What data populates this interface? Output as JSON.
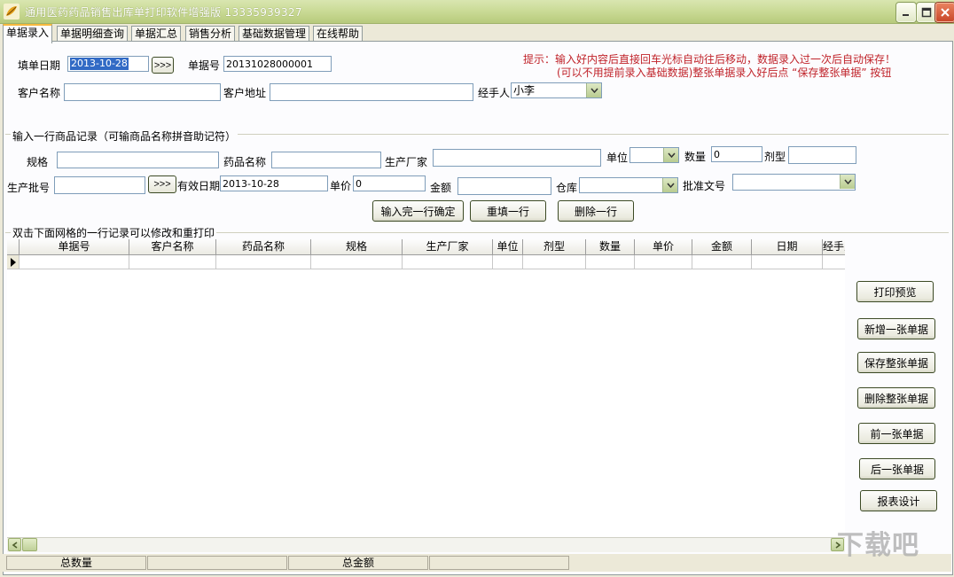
{
  "window": {
    "title": "通用医药药品销售出库单打印软件增强版 13335939327",
    "icon": "app-leaf-icon"
  },
  "tabs": [
    "单据录入",
    "单据明细查询",
    "单据汇总",
    "销售分析",
    "基础数据管理",
    "在线帮助"
  ],
  "header_form": {
    "date_label": "填单日期",
    "date_value": "2013-10-28",
    "date_picker_label": ">>>",
    "docno_label": "单据号",
    "docno_value": "20131028000001",
    "customer_label": "客户名称",
    "customer_value": "",
    "address_label": "客户地址",
    "address_value": "",
    "handler_label": "经手人",
    "handler_value": "小李",
    "hint_line1": "提示：输入好内容后直接回车光标自动往后移动，数据录入过一次后自动保存！",
    "hint_line2": "(可以不用提前录入基础数据)整张单据录入好后点 “保存整张单据” 按钮"
  },
  "item_form": {
    "group_title": "输入一行商品记录（可输商品名称拼音助记符）",
    "spec_label": "规格",
    "drug_label": "药品名称",
    "maker_label": "生产厂家",
    "unit_label": "单位",
    "qty_label": "数量",
    "qty_value": "0",
    "form_label": "剂型",
    "batch_label": "生产批号",
    "batch_btn_label": ">>>",
    "expiry_label": "有效日期",
    "expiry_value": "2013-10-28",
    "price_label": "单价",
    "price_value": "0",
    "amount_label": "金额",
    "warehouse_label": "仓库",
    "approval_label": "批准文号",
    "btn_confirm": "输入完一行确定",
    "btn_refill": "重填一行",
    "btn_delete_row": "删除一行"
  },
  "grid": {
    "group_title": "双击下面网格的一行记录可以修改和重打印",
    "columns": [
      "单据号",
      "客户名称",
      "药品名称",
      "规格",
      "生产厂家",
      "单位",
      "剂型",
      "数量",
      "单价",
      "金额",
      "日期",
      "经手人"
    ]
  },
  "side_buttons": [
    "打印预览",
    "新增一张单据",
    "保存整张单据",
    "删除整张单据",
    "前一张单据",
    "后一张单据",
    "报表设计"
  ],
  "status": {
    "total_qty_label": "总数量",
    "total_amount_label": "总金额"
  },
  "watermark": "下载吧"
}
